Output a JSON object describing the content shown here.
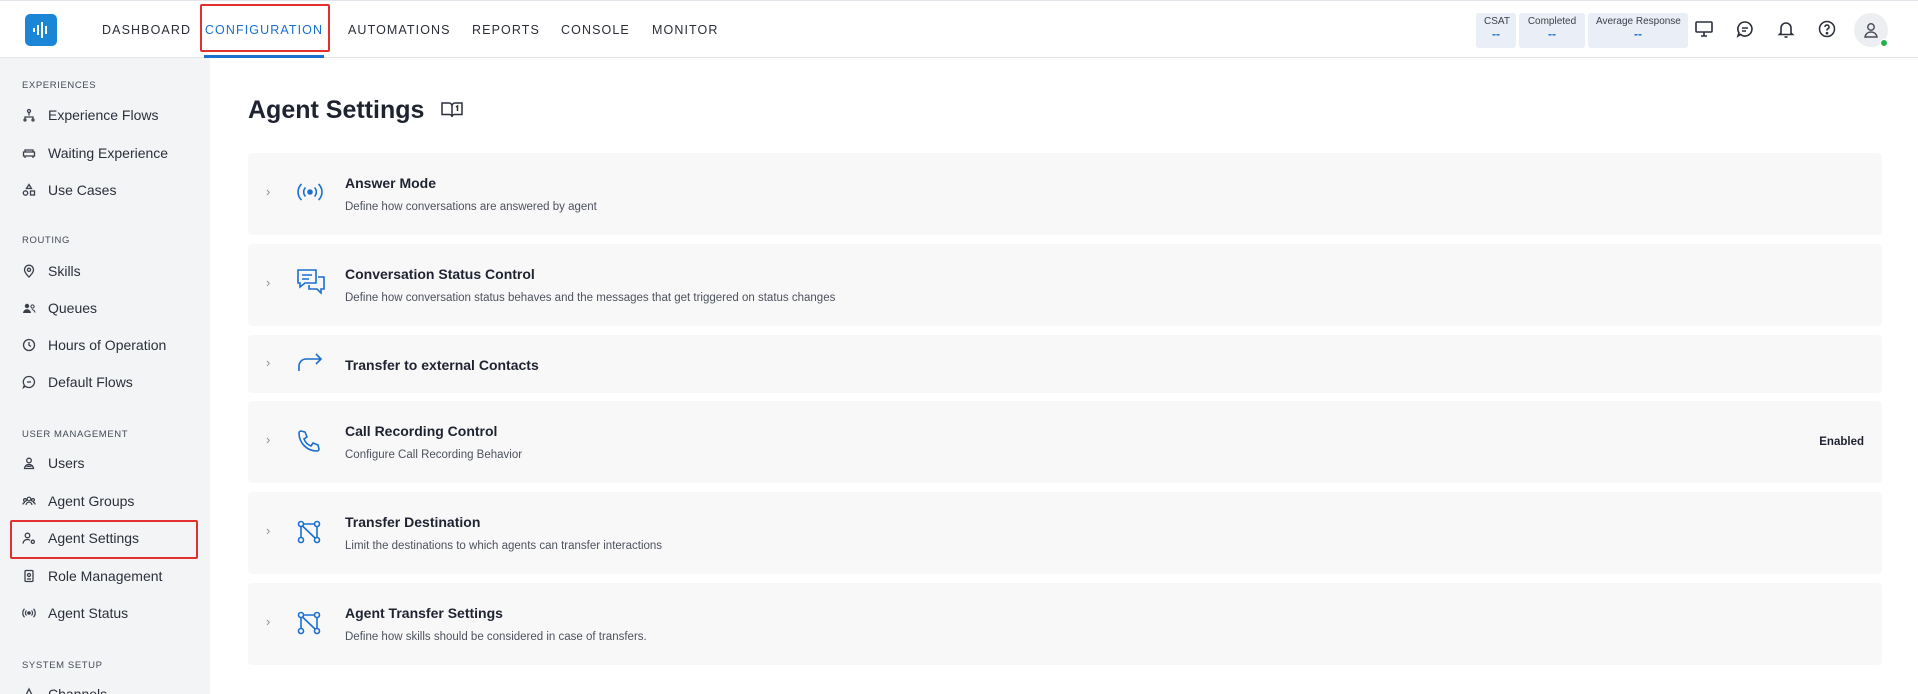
{
  "header": {
    "nav": [
      {
        "label": "DASHBOARD"
      },
      {
        "label": "CONFIGURATION",
        "active": true
      },
      {
        "label": "AUTOMATIONS"
      },
      {
        "label": "REPORTS"
      },
      {
        "label": "CONSOLE"
      },
      {
        "label": "MONITOR"
      }
    ],
    "metrics": [
      {
        "label": "CSAT",
        "value": "--"
      },
      {
        "label": "Completed",
        "value": "--"
      },
      {
        "label": "Average Response",
        "value": "--"
      }
    ],
    "icons": [
      "monitor-icon",
      "chat-icon",
      "bell-icon",
      "help-icon",
      "user-avatar-icon"
    ]
  },
  "sidebar": {
    "sections": [
      {
        "title": "EXPERIENCES",
        "items": [
          {
            "label": "Experience Flows",
            "icon": "flow-icon"
          },
          {
            "label": "Waiting Experience",
            "icon": "sofa-icon"
          },
          {
            "label": "Use Cases",
            "icon": "shapes-icon"
          }
        ]
      },
      {
        "title": "ROUTING",
        "items": [
          {
            "label": "Skills",
            "icon": "pin-icon"
          },
          {
            "label": "Queues",
            "icon": "people-icon"
          },
          {
            "label": "Hours of Operation",
            "icon": "clock-icon"
          },
          {
            "label": "Default Flows",
            "icon": "chat-flow-icon"
          }
        ]
      },
      {
        "title": "USER MANAGEMENT",
        "items": [
          {
            "label": "Users",
            "icon": "users-icon"
          },
          {
            "label": "Agent Groups",
            "icon": "group-icon"
          },
          {
            "label": "Agent Settings",
            "icon": "user-gear-icon",
            "active": true
          },
          {
            "label": "Role Management",
            "icon": "badge-icon"
          },
          {
            "label": "Agent Status",
            "icon": "broadcast-icon"
          }
        ]
      },
      {
        "title": "SYSTEM SETUP",
        "items": [
          {
            "label": "Channels",
            "icon": "channels-icon"
          }
        ]
      }
    ]
  },
  "main": {
    "title": "Agent Settings",
    "cards": [
      {
        "title": "Answer Mode",
        "description": "Define how conversations are answered by agent",
        "icon": "broadcast-icon",
        "status": ""
      },
      {
        "title": "Conversation Status Control",
        "description": "Define how conversation status behaves and the messages that get triggered on status changes",
        "icon": "chat-bubbles-icon",
        "status": ""
      },
      {
        "title": "Transfer to external Contacts",
        "description": "",
        "icon": "forward-arrow-icon",
        "status": ""
      },
      {
        "title": "Call Recording Control",
        "description": "Configure Call Recording Behavior",
        "icon": "phone-icon",
        "status": "Enabled"
      },
      {
        "title": "Transfer Destination",
        "description": "Limit the destinations to which agents can transfer interactions",
        "icon": "transfer-nodes-icon",
        "status": ""
      },
      {
        "title": "Agent Transfer Settings",
        "description": "Define how skills should be considered in case of transfers.",
        "icon": "transfer-nodes-icon",
        "status": ""
      }
    ]
  },
  "colors": {
    "accent": "#1b6fd0",
    "logo": "#1b86d6",
    "highlight_box": "#e2302f",
    "online": "#24b04b"
  }
}
